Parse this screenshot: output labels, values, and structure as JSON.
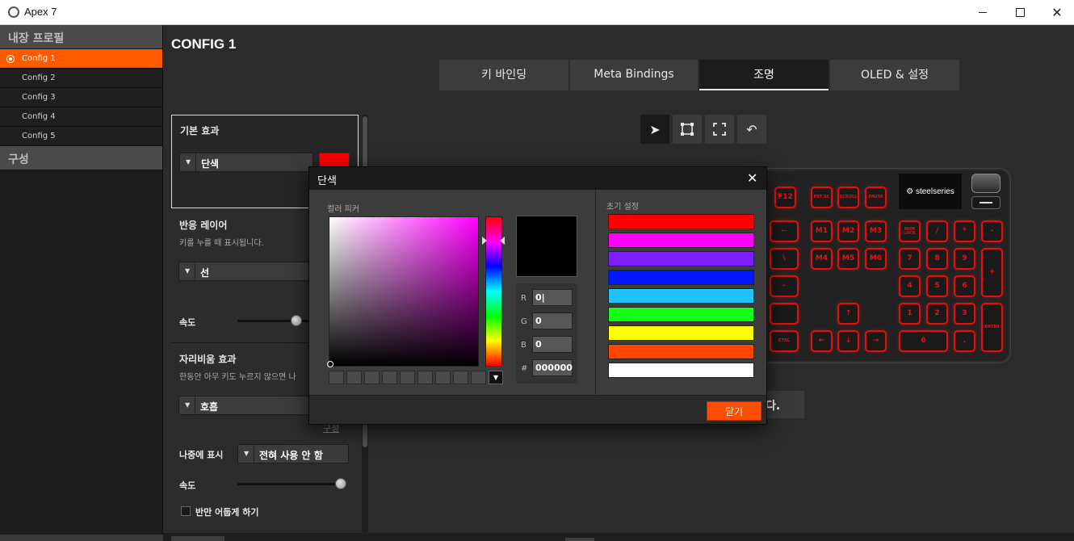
{
  "window": {
    "title": "Apex 7",
    "app_icon": "steelseries-engine-icon"
  },
  "sidebar": {
    "header": "내장 프로필",
    "items": [
      "Config 1",
      "Config 2",
      "Config 3",
      "Config 4",
      "Config 5"
    ],
    "active_index": 0,
    "section2": "구성"
  },
  "page": {
    "title": "CONFIG 1"
  },
  "tabs": [
    "키 바인딩",
    "Meta Bindings",
    "조명",
    "OLED & 설정"
  ],
  "active_tab": "조명",
  "settings": {
    "base_effect": {
      "title": "기본 효과",
      "value": "단색",
      "color": "#ff0000"
    },
    "reactive_layer": {
      "title": "반응 레이어",
      "desc": "키를 누를 때 표시됩니다.",
      "value": "선",
      "speed_label": "속도"
    },
    "idle_effect": {
      "title": "자리비움 효과",
      "desc": "한동안 아무 키도 누르지 않으면 나",
      "value": "호흡",
      "link": "구성"
    },
    "show_later": {
      "label": "나중에 표시",
      "value": "전혀 사용 안 함"
    },
    "speed_label": "속도",
    "dim_half": "반만 어둡게 하기"
  },
  "keyboard": {
    "logo": "steelseries",
    "keys": {
      "f12": "F12",
      "prtsc": "PRT SC",
      "scroll": "SCROLL",
      "pause": "PAUSE",
      "m1": "M1",
      "m2": "M2",
      "m3": "M3",
      "num": "NUM LOCK",
      "slash": "/",
      "star": "*",
      "minus": "-",
      "m4": "M4",
      "m5": "M5",
      "m6": "M6",
      "n7": "7",
      "n8": "8",
      "n9": "9",
      "plus": "+",
      "n4": "4",
      "n5": "5",
      "n6": "6",
      "up": "↑",
      "n1": "1",
      "n2": "2",
      "n3": "3",
      "enter": "ENTER",
      "ctrl": "CTRL",
      "left": "←",
      "down": "↓",
      "right": "→",
      "n0": "0",
      "dot": "."
    }
  },
  "background_message_tail": "다.",
  "dialog": {
    "title": "단색",
    "picker_label": "컬러 피커",
    "preset_label": "초기 설정",
    "r_label": "R",
    "g_label": "G",
    "b_label": "B",
    "hex_label": "#",
    "r_value": "0",
    "g_value": "0",
    "b_value": "0",
    "hex_value": "000000",
    "preview_color": "#000000",
    "presets": [
      "#ff0000",
      "#ff00ff",
      "#7b1fff",
      "#0016ff",
      "#21c3ff",
      "#14ff14",
      "#ffff00",
      "#ff4500",
      "#ffffff"
    ],
    "close_label": "닫기"
  }
}
